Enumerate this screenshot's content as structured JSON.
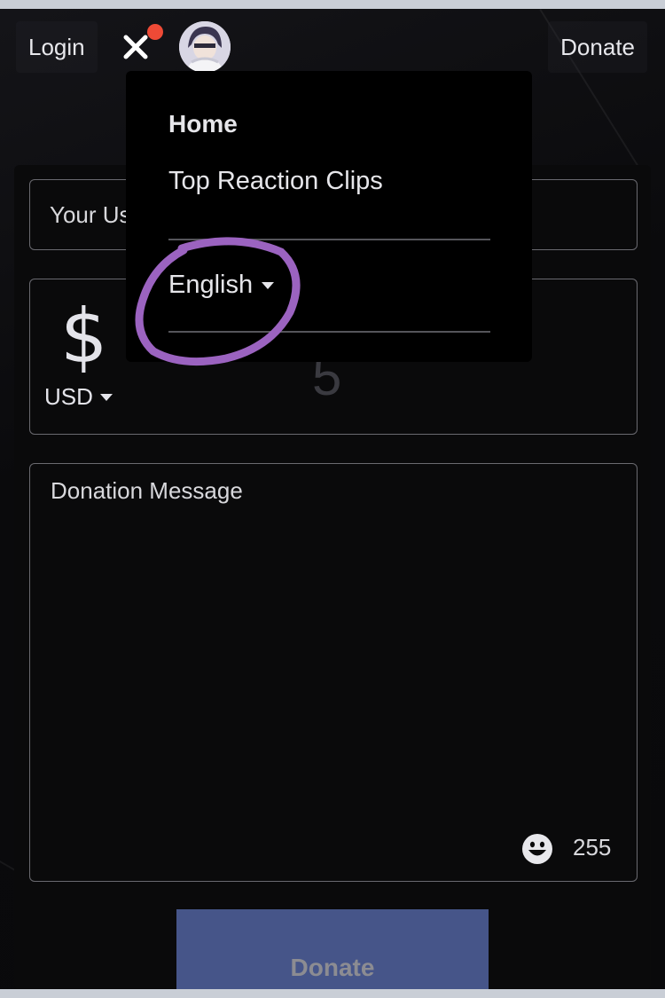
{
  "header": {
    "login_label": "Login",
    "donate_label": "Donate"
  },
  "menu": {
    "items": [
      {
        "label": "Home"
      },
      {
        "label": "Top Reaction Clips"
      }
    ],
    "language": "English"
  },
  "form": {
    "username_placeholder": "Your Us",
    "currency_symbol": "$",
    "currency_code": "USD",
    "amount_value": "5",
    "message_placeholder": "Donation Message",
    "char_remaining": "255",
    "submit_label": "Donate"
  },
  "colors": {
    "background": "#0b0b0d",
    "menu_bg": "#000000",
    "notification_dot": "#ee4a36",
    "annotation_circle": "#9b63c0",
    "submit_button": "#465589"
  }
}
